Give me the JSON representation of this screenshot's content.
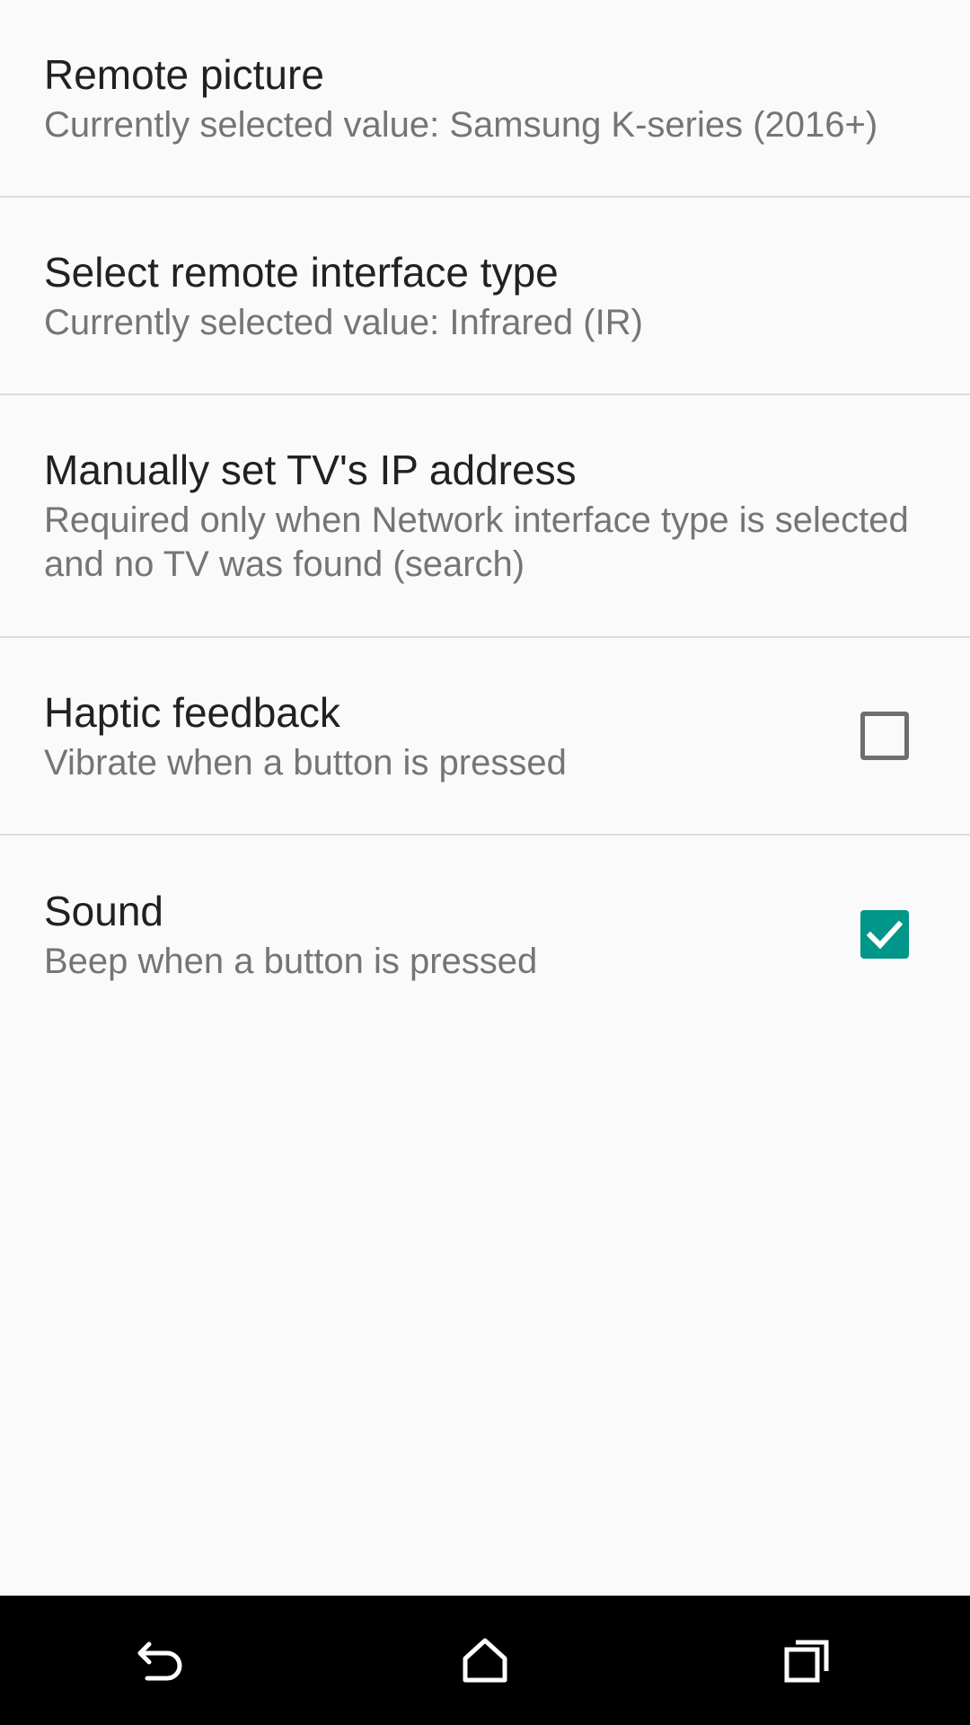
{
  "preferences": [
    {
      "title": "Remote picture",
      "summary": "Currently selected value: Samsung K-series (2016+)"
    },
    {
      "title": "Select remote interface type",
      "summary": "Currently selected value: Infrared (IR)"
    },
    {
      "title": "Manually set TV's IP address",
      "summary": "Required only when Network interface type is selected and no TV was found (search)"
    },
    {
      "title": "Haptic feedback",
      "summary": "Vibrate when a button is pressed",
      "checked": false
    },
    {
      "title": "Sound",
      "summary": "Beep when a button is pressed",
      "checked": true
    }
  ],
  "colors": {
    "accent": "#00968a",
    "background": "#fafafa",
    "divider": "#dcdcdc",
    "title_text": "#212121",
    "summary_text": "#757575",
    "nav_bar": "#000000"
  },
  "nav_bar": {
    "icons": [
      "back-icon",
      "home-icon",
      "recents-icon"
    ]
  }
}
